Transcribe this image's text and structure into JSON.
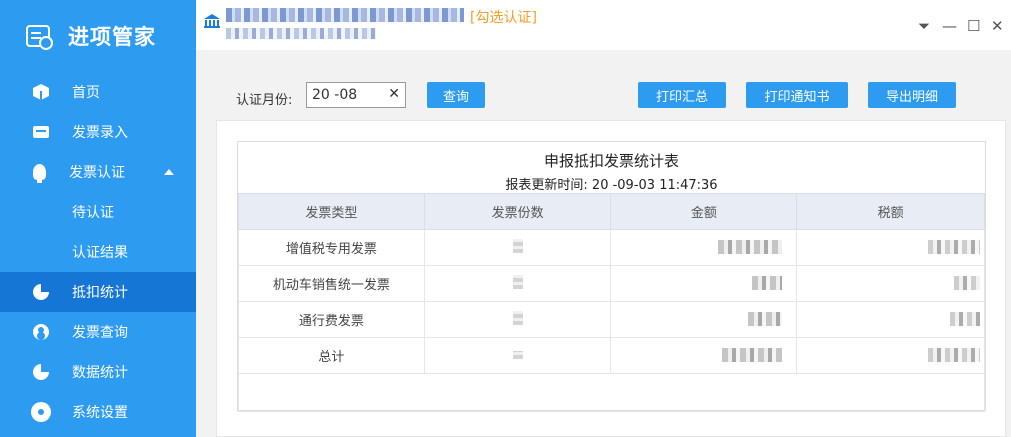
{
  "app": {
    "title": "进项管家"
  },
  "sidebar": {
    "items": [
      {
        "label": "首页",
        "icon": "cube-icon"
      },
      {
        "label": "发票录入",
        "icon": "card-icon"
      },
      {
        "label": "发票认证",
        "icon": "bulb-icon",
        "expanded": true
      },
      {
        "label": "待认证",
        "sub": true
      },
      {
        "label": "认证结果",
        "sub": true
      },
      {
        "label": "抵扣统计",
        "icon": "pie-icon",
        "active": true
      },
      {
        "label": "发票查询",
        "icon": "user-icon"
      },
      {
        "label": "数据统计",
        "icon": "pie-icon"
      },
      {
        "label": "系统设置",
        "icon": "gear-icon"
      }
    ]
  },
  "header": {
    "tick_link": "[勾选认证]",
    "window_controls": {
      "menu": "⏷",
      "minimize": "—",
      "maximize": "☐",
      "close": "✕"
    }
  },
  "toolbar": {
    "month_label": "认证月份:",
    "month_value": "20  -08",
    "clear_symbol": "✕",
    "query_label": "查询",
    "print_summary_label": "打印汇总",
    "print_notice_label": "打印通知书",
    "export_detail_label": "导出明细"
  },
  "report": {
    "title": "申报抵扣发票统计表",
    "updated": "报表更新时间: 20  -09-03 11:47:36",
    "columns": [
      "发票类型",
      "发票份数",
      "金额",
      "税额"
    ],
    "rows": [
      {
        "type": "增值税专用发票"
      },
      {
        "type": "机动车销售统一发票"
      },
      {
        "type": "通行费发票"
      },
      {
        "type": "总计"
      }
    ]
  },
  "colors": {
    "sidebar": "#2c9bf0",
    "active": "#1576d6",
    "button": "#2c9bf0",
    "link": "#f0a020"
  }
}
